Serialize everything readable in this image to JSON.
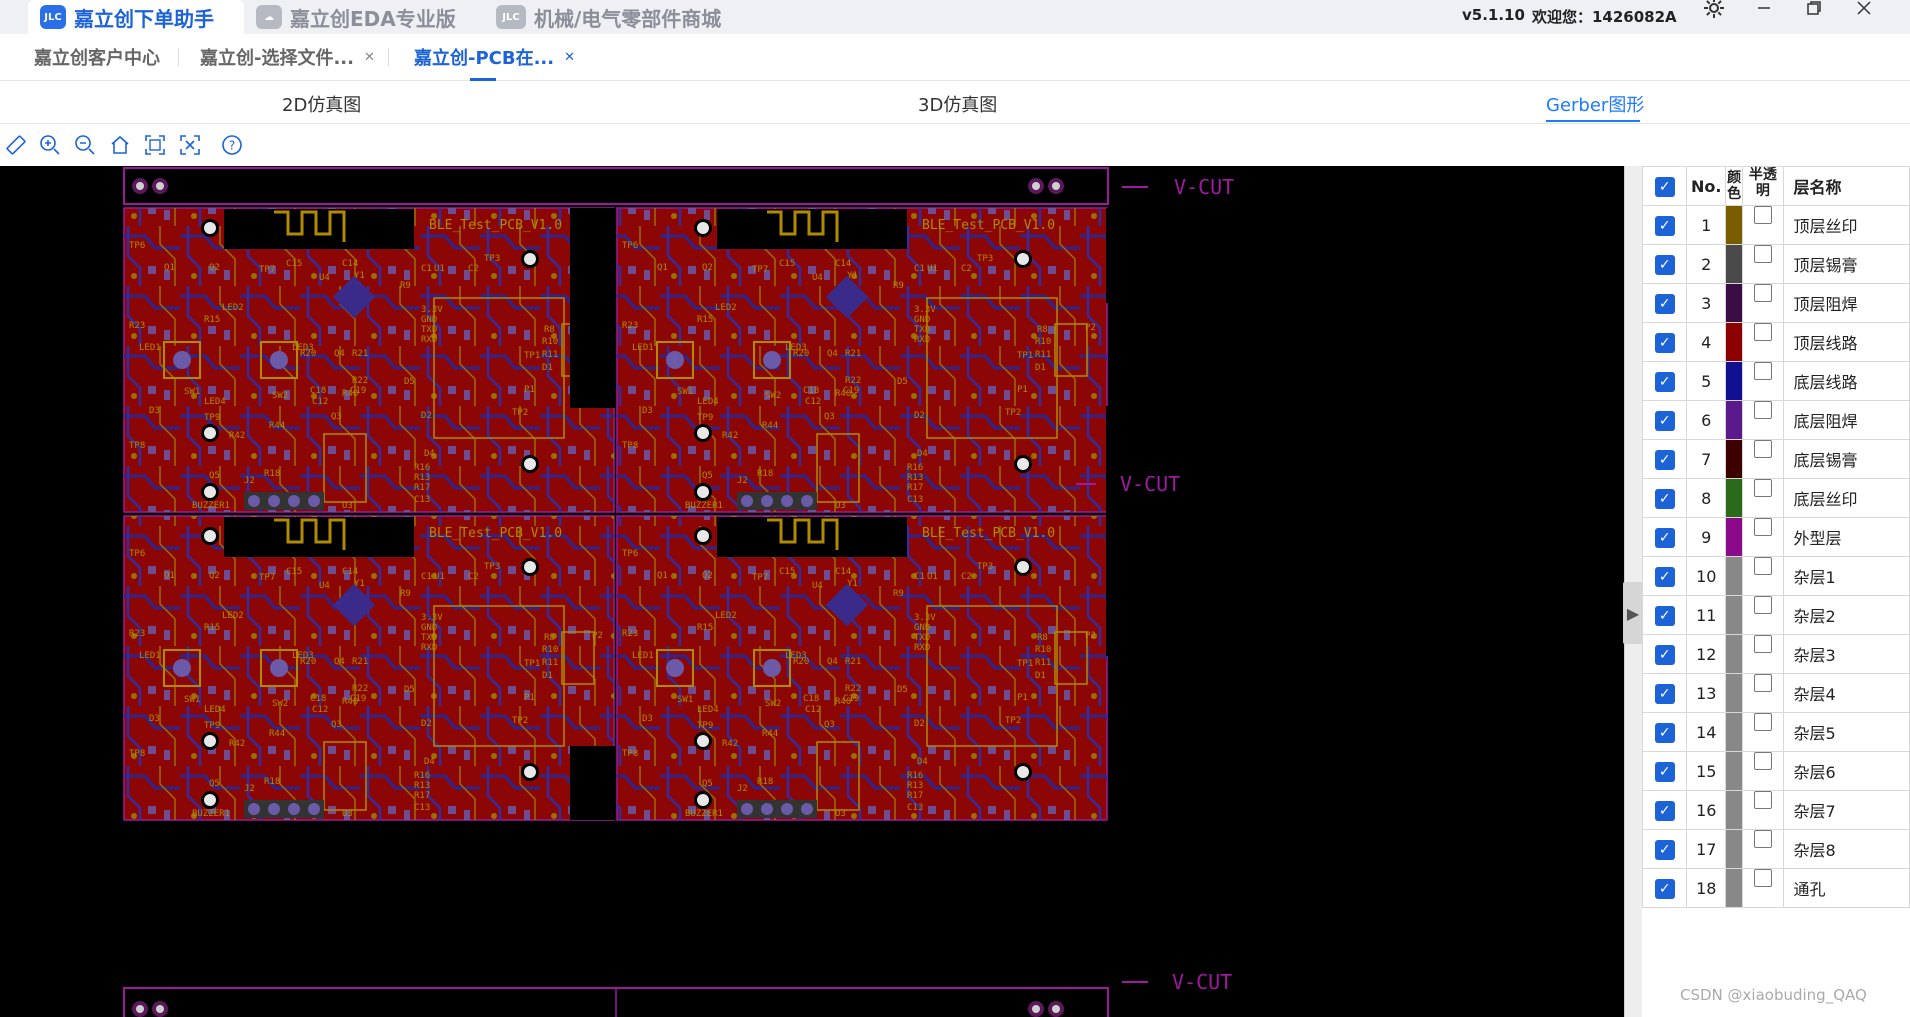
{
  "app_tabs": [
    {
      "label": "嘉立创下单助手",
      "active": true,
      "icon": "jlc-logo-icon"
    },
    {
      "label": "嘉立创EDA专业版",
      "active": false,
      "icon": "eda-cloud-icon"
    },
    {
      "label": "机械/电气零部件商城",
      "active": false,
      "icon": "jlcmc-logo-icon"
    }
  ],
  "titlebar": {
    "version": "v5.1.10",
    "welcome": "欢迎您：1426082A",
    "icons": [
      "gear-icon",
      "minimize-icon",
      "maximize-icon",
      "close-icon"
    ]
  },
  "browser_tabs": [
    {
      "label": "嘉立创客户中心",
      "closable": false,
      "active": false
    },
    {
      "label": "嘉立创-选择文件...",
      "closable": true,
      "active": false
    },
    {
      "label": "嘉立创-PCB在...",
      "closable": true,
      "active": true
    }
  ],
  "view_tabs": [
    {
      "label": "2D仿真图",
      "active": false
    },
    {
      "label": "3D仿真图",
      "active": false
    },
    {
      "label": "Gerber图形",
      "active": true
    }
  ],
  "toolbar": [
    "ruler-icon",
    "zoom-in-icon",
    "zoom-out-icon",
    "home-icon",
    "fit-view-icon",
    "fullscreen-icon",
    "help-icon"
  ],
  "pcb": {
    "board_label": "BLE_Test_PCB_V1.0",
    "vcut_labels": [
      "V-CUT",
      "V-CUT",
      "V-CUT"
    ],
    "silk_labels": [
      "TP6",
      "TP7",
      "TP3",
      "TP1",
      "TP2",
      "TP8",
      "TP9",
      "C15",
      "C14",
      "C1",
      "U1",
      "C2",
      "U4",
      "Y1",
      "R9",
      "R8",
      "R10",
      "R11",
      "D1",
      "P2",
      "P1",
      "LED1",
      "LED2",
      "LED3",
      "LED4",
      "SW1",
      "SW2",
      "R20",
      "R21",
      "R22",
      "R23",
      "Q1",
      "Q2",
      "Q3",
      "Q4",
      "Q5",
      "C18",
      "C12",
      "C19",
      "R40",
      "R42",
      "R44",
      "R18",
      "R13",
      "R16",
      "R17",
      "C13",
      "D2",
      "D3",
      "D4",
      "D5",
      "J2",
      "U3",
      "BUZZER1",
      "3.3V",
      "GND",
      "TXD",
      "RXD",
      "R15"
    ]
  },
  "layer_table": {
    "header": {
      "no": "No.",
      "color": "颜色",
      "semi": "半透明",
      "name": "层名称"
    },
    "rows": [
      {
        "no": "1",
        "color": "#7a5c00",
        "name": "顶层丝印"
      },
      {
        "no": "2",
        "color": "#4a4a4a",
        "name": "顶层锡膏"
      },
      {
        "no": "3",
        "color": "#3a0e44",
        "name": "顶层阻焊"
      },
      {
        "no": "4",
        "color": "#8c0000",
        "name": "顶层线路"
      },
      {
        "no": "5",
        "color": "#101090",
        "name": "底层线路"
      },
      {
        "no": "6",
        "color": "#5a1a8c",
        "name": "底层阻焊"
      },
      {
        "no": "7",
        "color": "#3c0000",
        "name": "底层锡膏"
      },
      {
        "no": "8",
        "color": "#2a6a1a",
        "name": "底层丝印"
      },
      {
        "no": "9",
        "color": "#8a0a8a",
        "name": "外型层"
      },
      {
        "no": "10",
        "color": "#888888",
        "name": "杂层1"
      },
      {
        "no": "11",
        "color": "#888888",
        "name": "杂层2"
      },
      {
        "no": "12",
        "color": "#888888",
        "name": "杂层3"
      },
      {
        "no": "13",
        "color": "#888888",
        "name": "杂层4"
      },
      {
        "no": "14",
        "color": "#888888",
        "name": "杂层5"
      },
      {
        "no": "15",
        "color": "#888888",
        "name": "杂层6"
      },
      {
        "no": "16",
        "color": "#888888",
        "name": "杂层7"
      },
      {
        "no": "17",
        "color": "#888888",
        "name": "杂层8"
      },
      {
        "no": "18",
        "color": "#888888",
        "name": "通孔"
      }
    ]
  },
  "watermark": "CSDN @xiaobuding_QAQ"
}
